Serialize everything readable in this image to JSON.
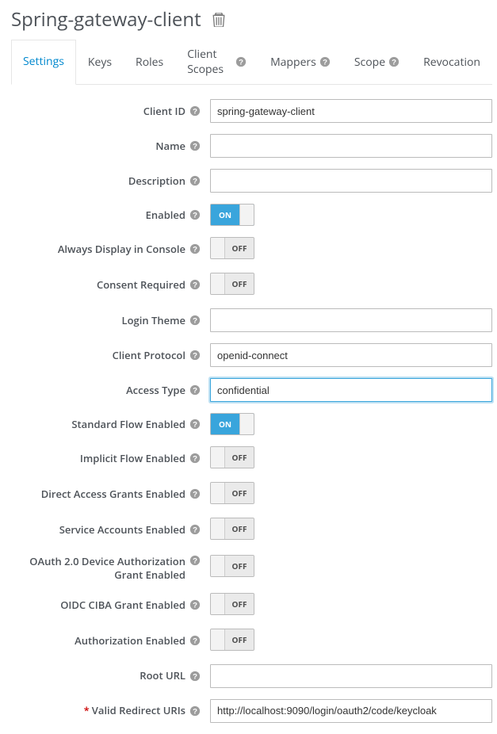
{
  "header": {
    "title": "Spring-gateway-client"
  },
  "tabs": [
    {
      "label": "Settings",
      "help": false,
      "active": true
    },
    {
      "label": "Keys",
      "help": false,
      "active": false
    },
    {
      "label": "Roles",
      "help": false,
      "active": false
    },
    {
      "label": "Client Scopes",
      "help": true,
      "active": false
    },
    {
      "label": "Mappers",
      "help": true,
      "active": false
    },
    {
      "label": "Scope",
      "help": true,
      "active": false
    },
    {
      "label": "Revocation",
      "help": false,
      "active": false
    }
  ],
  "form": {
    "clientId": {
      "label": "Client ID",
      "value": "spring-gateway-client",
      "type": "text",
      "required": false
    },
    "name": {
      "label": "Name",
      "value": "",
      "type": "text",
      "required": false
    },
    "description": {
      "label": "Description",
      "value": "",
      "type": "text",
      "required": false
    },
    "enabled": {
      "label": "Enabled",
      "value": true,
      "type": "toggle",
      "required": false
    },
    "displayInConsole": {
      "label": "Always Display in Console",
      "value": false,
      "type": "toggle",
      "required": false
    },
    "consentRequired": {
      "label": "Consent Required",
      "value": false,
      "type": "toggle",
      "required": false
    },
    "loginTheme": {
      "label": "Login Theme",
      "value": "",
      "type": "select",
      "required": false
    },
    "clientProtocol": {
      "label": "Client Protocol",
      "value": "openid-connect",
      "type": "select",
      "required": false
    },
    "accessType": {
      "label": "Access Type",
      "value": "confidential",
      "type": "select",
      "required": false,
      "focused": true
    },
    "standardFlow": {
      "label": "Standard Flow Enabled",
      "value": true,
      "type": "toggle",
      "required": false
    },
    "implicitFlow": {
      "label": "Implicit Flow Enabled",
      "value": false,
      "type": "toggle",
      "required": false
    },
    "directAccess": {
      "label": "Direct Access Grants Enabled",
      "value": false,
      "type": "toggle",
      "required": false
    },
    "serviceAccounts": {
      "label": "Service Accounts Enabled",
      "value": false,
      "type": "toggle",
      "required": false
    },
    "deviceAuthGrant": {
      "label": "OAuth 2.0 Device Authorization Grant Enabled",
      "value": false,
      "type": "toggle",
      "required": false,
      "multiline": true
    },
    "cibaGrant": {
      "label": "OIDC CIBA Grant Enabled",
      "value": false,
      "type": "toggle",
      "required": false
    },
    "authorization": {
      "label": "Authorization Enabled",
      "value": false,
      "type": "toggle",
      "required": false
    },
    "rootUrl": {
      "label": "Root URL",
      "value": "",
      "type": "text",
      "required": false
    },
    "validRedirectUris": {
      "label": "Valid Redirect URIs",
      "value": "http://localhost:9090/login/oauth2/code/keycloak",
      "type": "text",
      "required": true
    }
  },
  "toggle": {
    "on": "ON",
    "off": "OFF"
  }
}
